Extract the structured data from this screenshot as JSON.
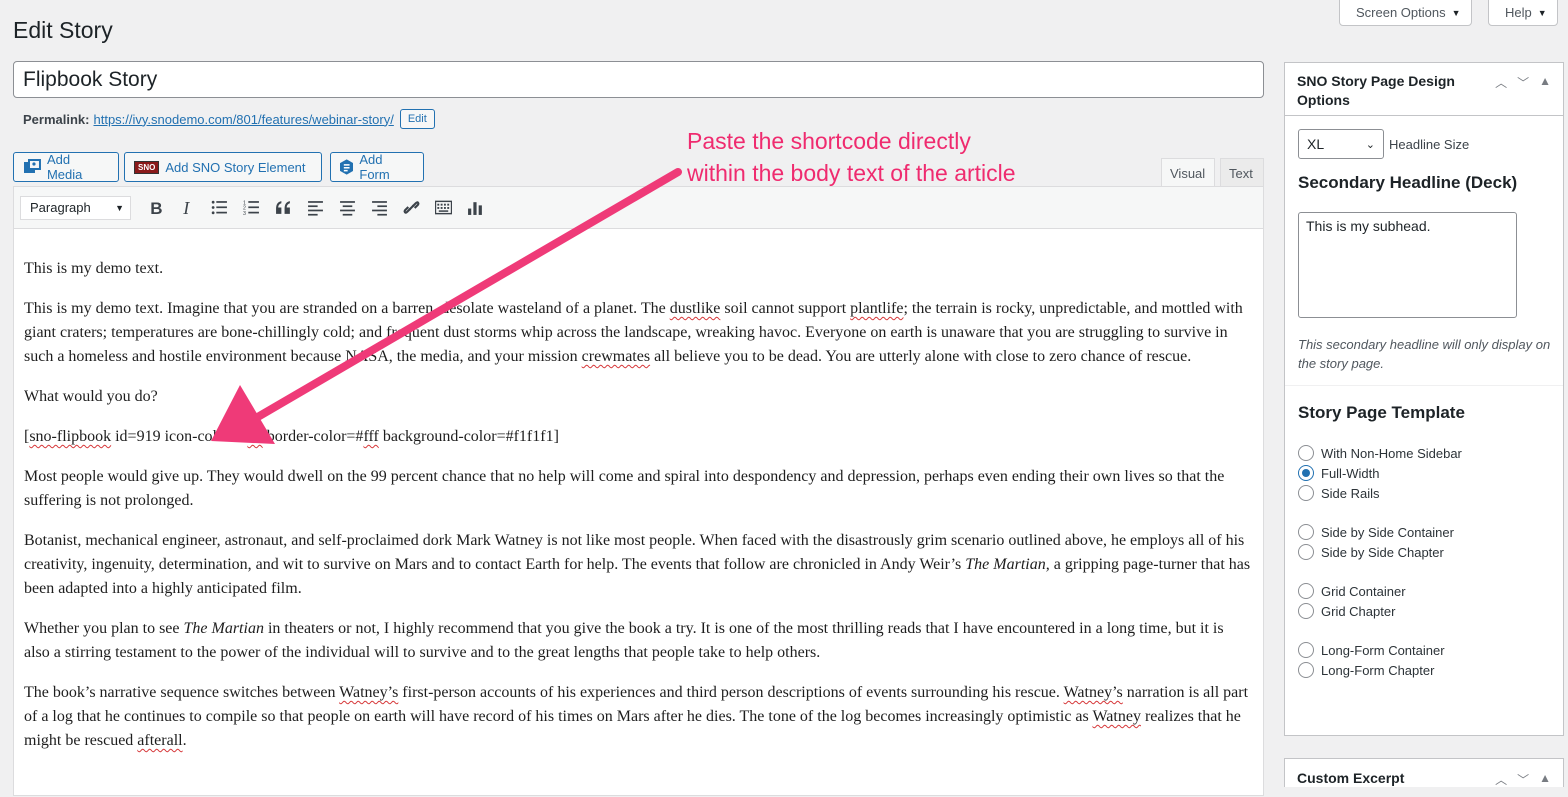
{
  "header": {
    "title": "Edit Story",
    "screen_options": "Screen Options",
    "help": "Help"
  },
  "post": {
    "title": "Flipbook Story",
    "permalink_label": "Permalink:",
    "permalink_url": "https://ivy.snodemo.com/801/features/webinar-story/",
    "permalink_edit": "Edit"
  },
  "media_buttons": {
    "add_media": "Add Media",
    "sno_logo": "SNO",
    "add_sno_element": "Add SNO Story Element",
    "add_form": "Add Form"
  },
  "editor": {
    "tab_visual": "Visual",
    "tab_text": "Text",
    "format_value": "Paragraph",
    "toolbar_icons": [
      "bold-icon",
      "italic-icon",
      "bulleted-list-icon",
      "numbered-list-icon",
      "blockquote-icon",
      "align-left-icon",
      "align-center-icon",
      "align-right-icon",
      "link-icon",
      "toolbar-toggle-icon",
      "chart-icon"
    ]
  },
  "annotation": {
    "line1": "Paste the shortcode directly",
    "line2": "within the body text of the article",
    "color": "#ef2b6f"
  },
  "sidebar": {
    "design_box": {
      "title": "SNO Story Page Design Options",
      "headline_size_value": "XL",
      "headline_size_label": "Headline Size",
      "deck_heading": "Secondary Headline (Deck)",
      "deck_value": "This is my subhead.",
      "deck_help": "This secondary headline will only display on the story page.",
      "template_heading": "Story Page Template",
      "templates": [
        {
          "label": "With Non-Home Sidebar",
          "checked": false
        },
        {
          "label": "Full-Width",
          "checked": true
        },
        {
          "label": "Side Rails",
          "checked": false
        },
        {
          "label": "Side by Side Container",
          "checked": false
        },
        {
          "label": "Side by Side Chapter",
          "checked": false
        },
        {
          "label": "Grid Container",
          "checked": false
        },
        {
          "label": "Grid Chapter",
          "checked": false
        },
        {
          "label": "Long-Form Container",
          "checked": false
        },
        {
          "label": "Long-Form Chapter",
          "checked": false
        }
      ]
    },
    "excerpt_box": {
      "title": "Custom Excerpt"
    }
  }
}
